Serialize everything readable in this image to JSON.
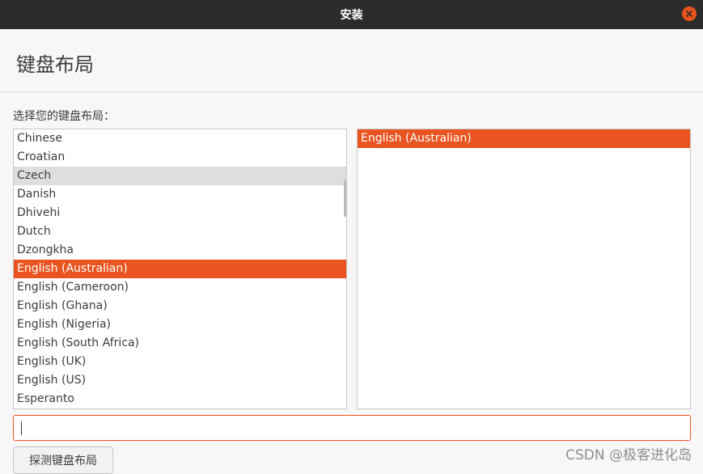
{
  "window": {
    "title": "安装"
  },
  "page": {
    "title": "键盘布局",
    "prompt": "选择您的键盘布局："
  },
  "layouts": {
    "items": [
      "Chinese",
      "Croatian",
      "Czech",
      "Danish",
      "Dhivehi",
      "Dutch",
      "Dzongkha",
      "English (Australian)",
      "English (Cameroon)",
      "English (Ghana)",
      "English (Nigeria)",
      "English (South Africa)",
      "English (UK)",
      "English (US)",
      "Esperanto"
    ],
    "hovered": "Czech",
    "selected": "English (Australian)"
  },
  "variants": {
    "items": [
      "English (Australian)"
    ],
    "selected": "English (Australian)"
  },
  "search": {
    "value": ""
  },
  "buttons": {
    "detect_label": "探测键盘布局"
  },
  "watermark": "CSDN @极客进化岛",
  "colors": {
    "accent": "#e95420",
    "titlebar": "#2c2c2c",
    "hover": "#dedede"
  },
  "icons": {
    "close": "close-icon"
  }
}
